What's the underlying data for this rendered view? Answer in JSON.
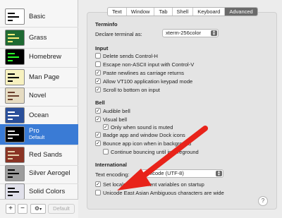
{
  "sidebar": {
    "profiles": [
      {
        "name": "Basic",
        "subtitle": "",
        "bg": "#ffffff",
        "fg": "#000000"
      },
      {
        "name": "Grass",
        "subtitle": "",
        "bg": "#1f6a33",
        "fg": "#ffef7a"
      },
      {
        "name": "Homebrew",
        "subtitle": "",
        "bg": "#000000",
        "fg": "#29ff29"
      },
      {
        "name": "Man Page",
        "subtitle": "",
        "bg": "#f7f1bf",
        "fg": "#000000"
      },
      {
        "name": "Novel",
        "subtitle": "",
        "bg": "#e6dcc2",
        "fg": "#6a3e2c"
      },
      {
        "name": "Ocean",
        "subtitle": "",
        "bg": "#2a4f9a",
        "fg": "#ffffff"
      },
      {
        "name": "Pro",
        "subtitle": "Default",
        "bg": "#000000",
        "fg": "#e8e8e8",
        "selected": true
      },
      {
        "name": "Red Sands",
        "subtitle": "",
        "bg": "#8a3424",
        "fg": "#e4cfa9"
      },
      {
        "name": "Silver Aerogel",
        "subtitle": "",
        "bg": "#9c9c9c",
        "fg": "#000000"
      },
      {
        "name": "Solid Colors",
        "subtitle": "",
        "bg": "#e0e0ea",
        "fg": "#000000"
      }
    ],
    "toolbar": {
      "add_label": "+",
      "remove_label": "−",
      "gear_label": "⚙",
      "gear_chevron": "▾",
      "default_label": "Default"
    }
  },
  "tabs": [
    {
      "label": "Text",
      "active": false
    },
    {
      "label": "Window",
      "active": false
    },
    {
      "label": "Tab",
      "active": false
    },
    {
      "label": "Shell",
      "active": false
    },
    {
      "label": "Keyboard",
      "active": false
    },
    {
      "label": "Advanced",
      "active": true
    }
  ],
  "terminfo": {
    "heading": "Terminfo",
    "declare_label": "Declare terminal as:",
    "declare_value": "xterm-256color"
  },
  "input": {
    "heading": "Input",
    "options": [
      {
        "label": "Delete sends Control-H",
        "checked": false
      },
      {
        "label": "Escape non-ASCII input with Control-V",
        "checked": false
      },
      {
        "label": "Paste newlines as carriage returns",
        "checked": true
      },
      {
        "label": "Allow VT100 application keypad mode",
        "checked": true
      },
      {
        "label": "Scroll to bottom on input",
        "checked": true
      }
    ]
  },
  "bell": {
    "heading": "Bell",
    "audible": {
      "label": "Audible bell",
      "checked": true
    },
    "visual": {
      "label": "Visual bell",
      "checked": true
    },
    "only_muted": {
      "label": "Only when sound is muted",
      "checked": true
    },
    "badge": {
      "label": "Badge app and window Dock icons",
      "checked": true
    },
    "bounce": {
      "label": "Bounce app icon when in background",
      "checked": true
    },
    "continue_bouncing": {
      "label": "Continue bouncing until in foreground",
      "checked": false
    }
  },
  "international": {
    "heading": "International",
    "encoding_label": "Text encoding:",
    "encoding_value": "Unicode (UTF-8)",
    "set_locale": {
      "label": "Set locale environment variables on startup",
      "checked": true
    },
    "east_asian": {
      "label": "Unicode East Asian Ambiguous characters are wide",
      "checked": false
    }
  },
  "help_label": "?",
  "annotation": {
    "arrow_color": "#e8231a"
  }
}
